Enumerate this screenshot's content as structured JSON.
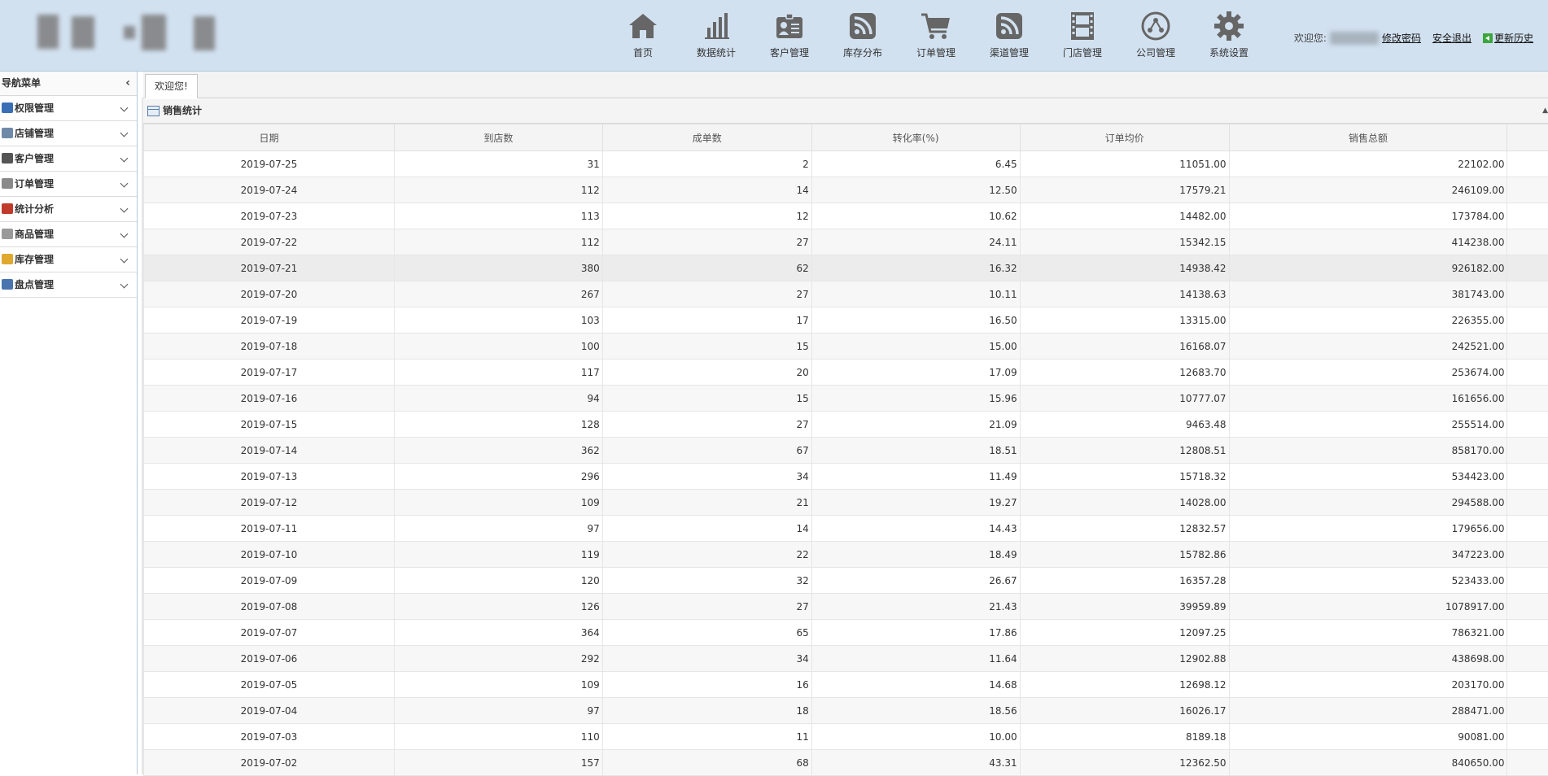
{
  "header": {
    "nav": [
      {
        "label": "首页",
        "icon": "home-icon"
      },
      {
        "label": "数据统计",
        "icon": "bar-chart-icon"
      },
      {
        "label": "客户管理",
        "icon": "id-card-icon"
      },
      {
        "label": "库存分布",
        "icon": "rss-icon"
      },
      {
        "label": "订单管理",
        "icon": "cart-icon"
      },
      {
        "label": "渠道管理",
        "icon": "rss-icon"
      },
      {
        "label": "门店管理",
        "icon": "film-icon"
      },
      {
        "label": "公司管理",
        "icon": "network-icon"
      },
      {
        "label": "系统设置",
        "icon": "gear-icon"
      }
    ],
    "user": {
      "welcome": "欢迎您:",
      "change_password": "修改密码",
      "logout": "安全退出",
      "update_history": "更新历史"
    }
  },
  "sidebar": {
    "title": "导航菜单",
    "collapse_glyph": "‹",
    "items": [
      {
        "label": "权限管理",
        "icon": "permission-icon",
        "color": "#3a6fb5"
      },
      {
        "label": "店铺管理",
        "icon": "shop-icon",
        "color": "#6f8aa8"
      },
      {
        "label": "客户管理",
        "icon": "penguin-icon",
        "color": "#555555"
      },
      {
        "label": "订单管理",
        "icon": "order-icon",
        "color": "#8a8a8a"
      },
      {
        "label": "统计分析",
        "icon": "chart-icon",
        "color": "#c0392b"
      },
      {
        "label": "商品管理",
        "icon": "box-icon",
        "color": "#9a9a9a"
      },
      {
        "label": "库存管理",
        "icon": "package-icon",
        "color": "#e0a82e"
      },
      {
        "label": "盘点管理",
        "icon": "inventory-check-icon",
        "color": "#4a74b0"
      }
    ]
  },
  "tabs": [
    {
      "label": "欢迎您!"
    }
  ],
  "panel": {
    "title": "销售统计",
    "collapse_glyph": "▲",
    "columns": [
      "日期",
      "到店数",
      "成单数",
      "转化率(%)",
      "订单均价",
      "销售总额"
    ],
    "highlight_row": 4,
    "rows": [
      [
        "2019-07-25",
        "31",
        "2",
        "6.45",
        "11051.00",
        "22102.00"
      ],
      [
        "2019-07-24",
        "112",
        "14",
        "12.50",
        "17579.21",
        "246109.00"
      ],
      [
        "2019-07-23",
        "113",
        "12",
        "10.62",
        "14482.00",
        "173784.00"
      ],
      [
        "2019-07-22",
        "112",
        "27",
        "24.11",
        "15342.15",
        "414238.00"
      ],
      [
        "2019-07-21",
        "380",
        "62",
        "16.32",
        "14938.42",
        "926182.00"
      ],
      [
        "2019-07-20",
        "267",
        "27",
        "10.11",
        "14138.63",
        "381743.00"
      ],
      [
        "2019-07-19",
        "103",
        "17",
        "16.50",
        "13315.00",
        "226355.00"
      ],
      [
        "2019-07-18",
        "100",
        "15",
        "15.00",
        "16168.07",
        "242521.00"
      ],
      [
        "2019-07-17",
        "117",
        "20",
        "17.09",
        "12683.70",
        "253674.00"
      ],
      [
        "2019-07-16",
        "94",
        "15",
        "15.96",
        "10777.07",
        "161656.00"
      ],
      [
        "2019-07-15",
        "128",
        "27",
        "21.09",
        "9463.48",
        "255514.00"
      ],
      [
        "2019-07-14",
        "362",
        "67",
        "18.51",
        "12808.51",
        "858170.00"
      ],
      [
        "2019-07-13",
        "296",
        "34",
        "11.49",
        "15718.32",
        "534423.00"
      ],
      [
        "2019-07-12",
        "109",
        "21",
        "19.27",
        "14028.00",
        "294588.00"
      ],
      [
        "2019-07-11",
        "97",
        "14",
        "14.43",
        "12832.57",
        "179656.00"
      ],
      [
        "2019-07-10",
        "119",
        "22",
        "18.49",
        "15782.86",
        "347223.00"
      ],
      [
        "2019-07-09",
        "120",
        "32",
        "26.67",
        "16357.28",
        "523433.00"
      ],
      [
        "2019-07-08",
        "126",
        "27",
        "21.43",
        "39959.89",
        "1078917.00"
      ],
      [
        "2019-07-07",
        "364",
        "65",
        "17.86",
        "12097.25",
        "786321.00"
      ],
      [
        "2019-07-06",
        "292",
        "34",
        "11.64",
        "12902.88",
        "438698.00"
      ],
      [
        "2019-07-05",
        "109",
        "16",
        "14.68",
        "12698.12",
        "203170.00"
      ],
      [
        "2019-07-04",
        "97",
        "18",
        "18.56",
        "16026.17",
        "288471.00"
      ],
      [
        "2019-07-03",
        "110",
        "11",
        "10.00",
        "8189.18",
        "90081.00"
      ],
      [
        "2019-07-02",
        "157",
        "68",
        "43.31",
        "12362.50",
        "840650.00"
      ]
    ]
  }
}
